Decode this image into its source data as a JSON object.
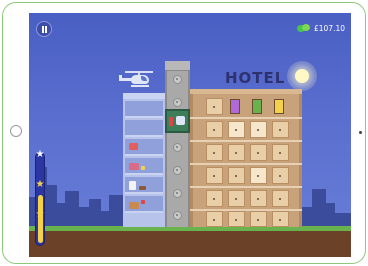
{
  "game": {
    "money": "£107.10",
    "hotel_sign": "HOTEL",
    "level_progress": 0.55,
    "icons": {
      "pause": "pause-icon",
      "money": "money-stack-icon",
      "star": "star-icon",
      "helicopter": "helicopter-icon",
      "sun": "sun-icon"
    },
    "colors": {
      "sky": "#5b6fd0",
      "hotel": "#c7a27a",
      "elevator": "#3d7d5a",
      "grass": "#69b34e",
      "dirt": "#6b4128",
      "progress_fill": "#f3d24a"
    },
    "stars": [
      "★",
      "★",
      "★"
    ]
  }
}
